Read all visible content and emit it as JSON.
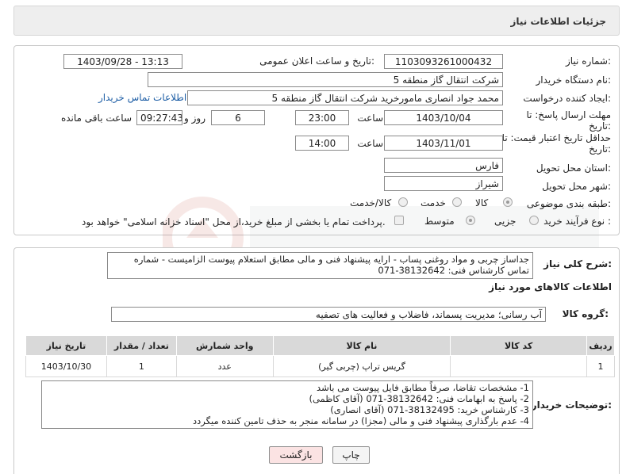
{
  "header": {
    "title": "جزئیات اطلاعات نیاز"
  },
  "form": {
    "need_number_label": "شماره نیاز:",
    "need_number": "1103093261000432",
    "announce_label": "تاریخ و ساعت اعلان عمومی:",
    "announce_value": "1403/09/28 - 13:13",
    "buyer_org_label": "نام دستگاه خریدار:",
    "buyer_org": "شرکت انتقال گاز منطقه 5",
    "creator_label": "ایجاد کننده درخواست:",
    "creator": "محمد جواد انصاری مامورخرید شرکت انتقال گاز منطقه 5",
    "buyer_contact_link": "اطلاعات تماس خریدار",
    "deadline_label_1": "مهلت ارسال پاسخ: تا",
    "deadline_label_2": "تاریخ:",
    "deadline_date": "1403/10/04",
    "time_label": "ساعت",
    "deadline_time": "23:00",
    "days_value": "6",
    "days_label": "روز و",
    "remaining_value": "09:27:43",
    "remaining_label": "ساعت باقی مانده",
    "min_validity_label_1": "حداقل تاریخ اعتبار قیمت: تا",
    "min_validity_label_2": "تاریخ:",
    "min_validity_date": "1403/11/01",
    "min_validity_time": "14:00",
    "province_label": "استان محل تحویل:",
    "province": "فارس",
    "city_label": "شهر محل تحویل:",
    "city": "شیراز",
    "category_label": "طبقه بندی موضوعی:",
    "category_options": [
      "کالا",
      "خدمت",
      "کالا/خدمت"
    ],
    "category_selected": "کالا",
    "process_label": "نوع فرآیند خرید :",
    "process_options": [
      "جزیی",
      "متوسط"
    ],
    "treasury_note": "پرداخت تمام یا بخشی از مبلغ خرید،از محل \"اسناد خزانه اسلامی\" خواهد بود."
  },
  "description": {
    "label": "شرح کلی نیاز:",
    "text_line1": "جداساز چربی و مواد روغنی پساب - ارایه پیشنهاد فنی و مالی مطابق استعلام پیوست الزامیست - شماره",
    "text_line2": "تماس کارشناس فنی: 38132642-071"
  },
  "goods_section_title": "اطلاعات کالاهای مورد نیاز",
  "goods_group": {
    "label": "گروه کالا:",
    "value": "آب رسانی؛ مدیریت پسماند، فاضلاب و فعالیت های تصفیه"
  },
  "table": {
    "headers": [
      "ردیف",
      "کد کالا",
      "نام کالا",
      "واحد شمارش",
      "تعداد / مقدار",
      "تاریخ نیاز"
    ],
    "rows": [
      {
        "row": "1",
        "code": "",
        "name": "گریس تراپ (چربی گیر)",
        "unit": "عدد",
        "qty": "1",
        "date": "1403/10/30"
      }
    ]
  },
  "buyer_notes": {
    "label": "توضیحات خریدار:",
    "lines": [
      "1-  مشخصات تقاضا، صرفاً مطابق فایل پیوست می باشد",
      "2- پاسخ به ابهامات فنی: 38132642-071 (آقای کاظمی)",
      "3- کارشناس خرید: 38132495-071 (آقای انصاری)",
      "4- عدم بارگذاری پیشنهاد فنی و مالی (مجزا) در سامانه منجر به حذف تامین کننده میگردد"
    ]
  },
  "buttons": {
    "print": "چاپ",
    "back": "بازگشت"
  },
  "colors": {
    "link": "#1f5fa6",
    "back_button_bg": "#fbe3e3",
    "header_bg": "#eeeeee",
    "table_header_bg": "#d9d9d9"
  },
  "icons": {
    "watermark": "ariatender-watermark-logo"
  }
}
